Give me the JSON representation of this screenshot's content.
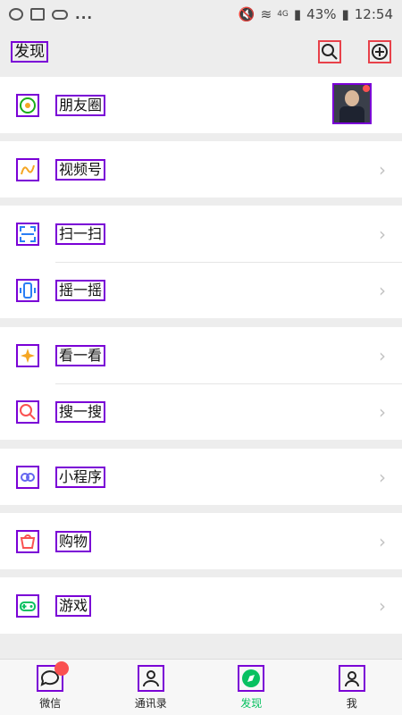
{
  "status_bar": {
    "network": "4G",
    "battery": "43%",
    "time": "12:54"
  },
  "header": {
    "title": "发现"
  },
  "groups": [
    {
      "items": [
        {
          "label": "朋友圈",
          "icon": "moments-icon",
          "color": "#1aad19",
          "chevron": false,
          "thumbnail": true
        }
      ]
    },
    {
      "items": [
        {
          "label": "视频号",
          "icon": "channels-icon",
          "color": "#f5a623",
          "chevron": true
        }
      ]
    },
    {
      "items": [
        {
          "label": "扫一扫",
          "icon": "scan-icon",
          "color": "#2a7ef5",
          "chevron": true
        },
        {
          "label": "摇一摇",
          "icon": "shake-icon",
          "color": "#2a7ef5",
          "chevron": true
        }
      ]
    },
    {
      "items": [
        {
          "label": "看一看",
          "icon": "look-icon",
          "color": "#f5a623",
          "chevron": true
        },
        {
          "label": "搜一搜",
          "icon": "search-one-icon",
          "color": "#fa5151",
          "chevron": true
        }
      ]
    },
    {
      "items": [
        {
          "label": "小程序",
          "icon": "mini-program-icon",
          "color": "#6467f0",
          "chevron": true
        }
      ]
    },
    {
      "items": [
        {
          "label": "购物",
          "icon": "shopping-icon",
          "color": "#fa5151",
          "chevron": true
        }
      ]
    },
    {
      "items": [
        {
          "label": "游戏",
          "icon": "game-icon",
          "color": "#07c160",
          "chevron": true
        }
      ]
    }
  ],
  "chevron": "›",
  "tabs": [
    {
      "label": "微信",
      "icon": "chat-icon",
      "badge": true
    },
    {
      "label": "通讯录",
      "icon": "contacts-icon",
      "badge": false
    },
    {
      "label": "发现",
      "icon": "discover-icon",
      "badge": false,
      "active": true
    },
    {
      "label": "我",
      "icon": "me-icon",
      "badge": false
    }
  ],
  "colors": {
    "accent": "#07c160",
    "badge": "#fa5151"
  }
}
